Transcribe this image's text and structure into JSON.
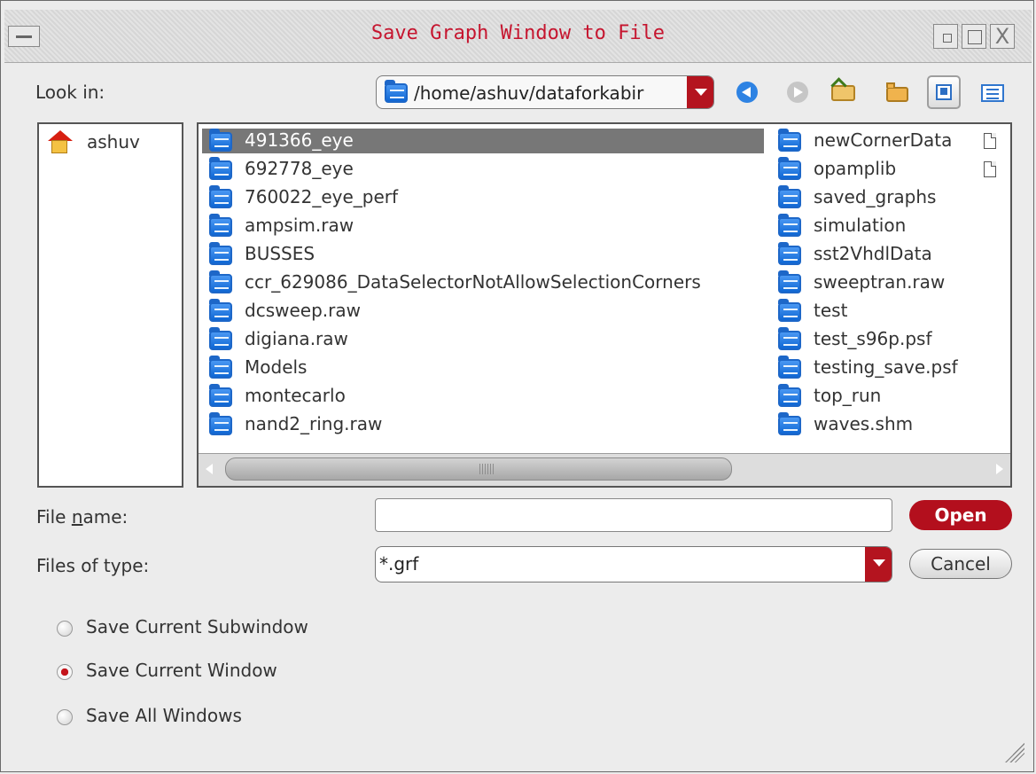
{
  "window": {
    "title": "Save Graph Window to File",
    "close_glyph": "X"
  },
  "look_in": {
    "label": "Look in:",
    "path": "/home/ashuv/dataforkabir"
  },
  "places": [
    {
      "label": "ashuv",
      "icon": "home-icon"
    }
  ],
  "files": {
    "left_column": [
      "491366_eye",
      "692778_eye",
      "760022_eye_perf",
      "ampsim.raw",
      "BUSSES",
      "ccr_629086_DataSelectorNotAllowSelectionCorners",
      "dcsweep.raw",
      "digiana.raw",
      "Models",
      "montecarlo",
      "nand2_ring.raw"
    ],
    "right_column": [
      "newCornerData",
      "opamplib",
      "saved_graphs",
      "simulation",
      "sst2VhdlData",
      "sweeptran.raw",
      "test",
      "test_s96p.psf",
      "testing_save.psf",
      "top_run",
      "waves.shm"
    ],
    "selected_file": "491366_eye"
  },
  "file_name": {
    "label_prefix": "File ",
    "label_underlined": "n",
    "label_suffix": "ame:",
    "value": "",
    "placeholder": ""
  },
  "file_type": {
    "label": "Files of type:",
    "selected": "*.grf"
  },
  "buttons": {
    "open": "Open",
    "cancel": "Cancel"
  },
  "save_options": [
    {
      "label": "Save Current Subwindow",
      "checked": false
    },
    {
      "label": "Save Current Window",
      "checked": true
    },
    {
      "label": "Save All Windows",
      "checked": false
    }
  ],
  "colors": {
    "accent_red": "#b30f1d",
    "folder_blue": "#1d67c8"
  }
}
